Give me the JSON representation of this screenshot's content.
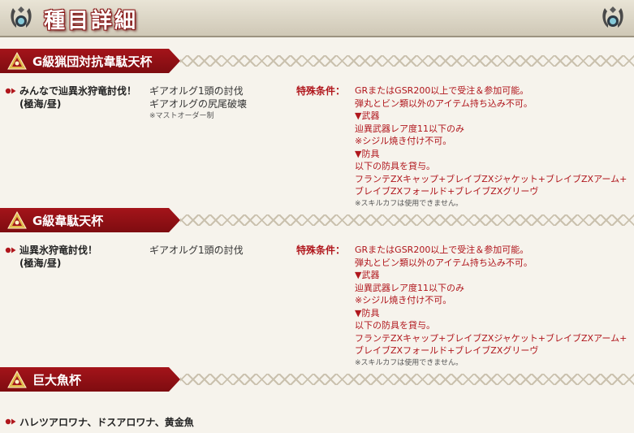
{
  "header": {
    "title": "種目詳細"
  },
  "sections": [
    {
      "banner": "G級猟団対抗韋駄天杯",
      "quest_line1": "みんなで辿異氷狩竜討伐！",
      "quest_line2": "(極海/昼)",
      "target_line1": "ギアオルグ1頭の討伐",
      "target_line2": "ギアオルグの尻尾破壊",
      "target_note": "※マストオーダー制",
      "condition_label": "特殊条件：",
      "conditions": [
        "GRまたはGSR200以上で受注＆参加可能。",
        "弾丸とビン類以外のアイテム持ち込み不可。",
        "▼武器",
        "辿異武器レア度11以下のみ",
        "※シジル焼き付け不可。",
        "▼防具",
        "以下の防具を貸与。",
        "フランテZXキャップ+ブレイブZXジャケット+ブレイブZXアーム+",
        "ブレイブZXフォールド+ブレイブZXグリーヴ"
      ],
      "condition_note": "※スキルカフは使用できません。"
    },
    {
      "banner": "G級韋駄天杯",
      "quest_line1": "辿異氷狩竜討伐！",
      "quest_line2": "(極海/昼)",
      "target_line1": "ギアオルグ1頭の討伐",
      "condition_label": "特殊条件：",
      "conditions": [
        "GRまたはGSR200以上で受注＆参加可能。",
        "弾丸とビン類以外のアイテム持ち込み不可。",
        "▼武器",
        "辿異武器レア度11以下のみ",
        "※シジル焼き付け不可。",
        "▼防具",
        "以下の防具を貸与。",
        "フランテZXキャップ+ブレイブZXジャケット+ブレイブZXアーム+",
        "ブレイブZXフォールド+ブレイブZXグリーヴ"
      ],
      "condition_note": "※スキルカフは使用できません。"
    },
    {
      "banner": "巨大魚杯",
      "fish": "ハレツアロワナ、ドスアロワナ、黄金魚"
    }
  ],
  "colors": {
    "accent": "#a4141a",
    "condition_text": "#b0161c",
    "background": "#f6f3ec"
  },
  "icons": {
    "crest": "crest-icon",
    "emblem": "trophy-emblem-icon",
    "bullet": "bullet-arrow-icon"
  }
}
